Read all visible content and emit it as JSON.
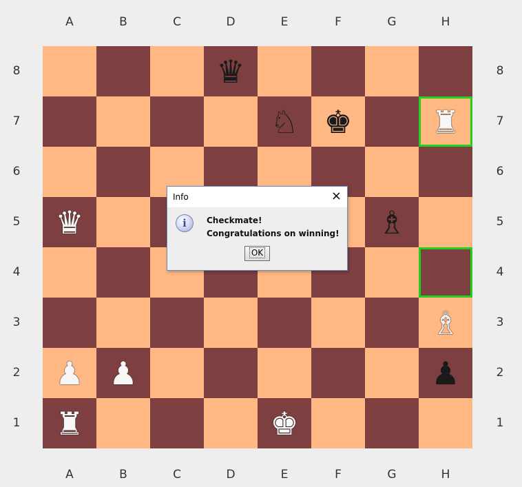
{
  "files": [
    "A",
    "B",
    "C",
    "D",
    "E",
    "F",
    "G",
    "H"
  ],
  "ranks": [
    "8",
    "7",
    "6",
    "5",
    "4",
    "3",
    "2",
    "1"
  ],
  "colors": {
    "light_square": "#ffb784",
    "dark_square": "#7d3f3f",
    "highlight": "#1ed21e",
    "background": "#eeeeee"
  },
  "pieces": [
    {
      "square": "D8",
      "color": "black",
      "type": "queen",
      "symbol": "♛",
      "icon": "black-queen-icon"
    },
    {
      "square": "E7",
      "color": "black",
      "type": "knight",
      "symbol": "♘",
      "icon": "black-knight-icon"
    },
    {
      "square": "F7",
      "color": "black",
      "type": "king",
      "symbol": "♚",
      "icon": "black-king-icon"
    },
    {
      "square": "H7",
      "color": "white",
      "type": "rook",
      "symbol": "♜",
      "icon": "white-rook-icon"
    },
    {
      "square": "A5",
      "color": "white",
      "type": "queen",
      "symbol": "♛",
      "icon": "white-queen-icon"
    },
    {
      "square": "G5",
      "color": "black",
      "type": "bishop",
      "symbol": "♗",
      "icon": "black-bishop-icon"
    },
    {
      "square": "H3",
      "color": "white",
      "type": "bishop",
      "symbol": "♗",
      "icon": "white-bishop-icon"
    },
    {
      "square": "A2",
      "color": "white",
      "type": "pawn",
      "symbol": "♟",
      "icon": "white-pawn-icon"
    },
    {
      "square": "B2",
      "color": "white",
      "type": "pawn",
      "symbol": "♟",
      "icon": "white-pawn-icon"
    },
    {
      "square": "H2",
      "color": "black",
      "type": "pawn",
      "symbol": "♟",
      "icon": "black-pawn-icon"
    },
    {
      "square": "A1",
      "color": "white",
      "type": "rook",
      "symbol": "♜",
      "icon": "white-rook-icon"
    },
    {
      "square": "E1",
      "color": "white",
      "type": "king",
      "symbol": "♚",
      "icon": "white-king-icon"
    }
  ],
  "highlighted_squares": [
    "H7",
    "H4"
  ],
  "dialog": {
    "title": "Info",
    "close_symbol": "×",
    "icon": "info-icon",
    "icon_glyph": "i",
    "message_line1": "Checkmate!",
    "message_line2": "Congratulations on winning!",
    "ok_label": "OK"
  }
}
